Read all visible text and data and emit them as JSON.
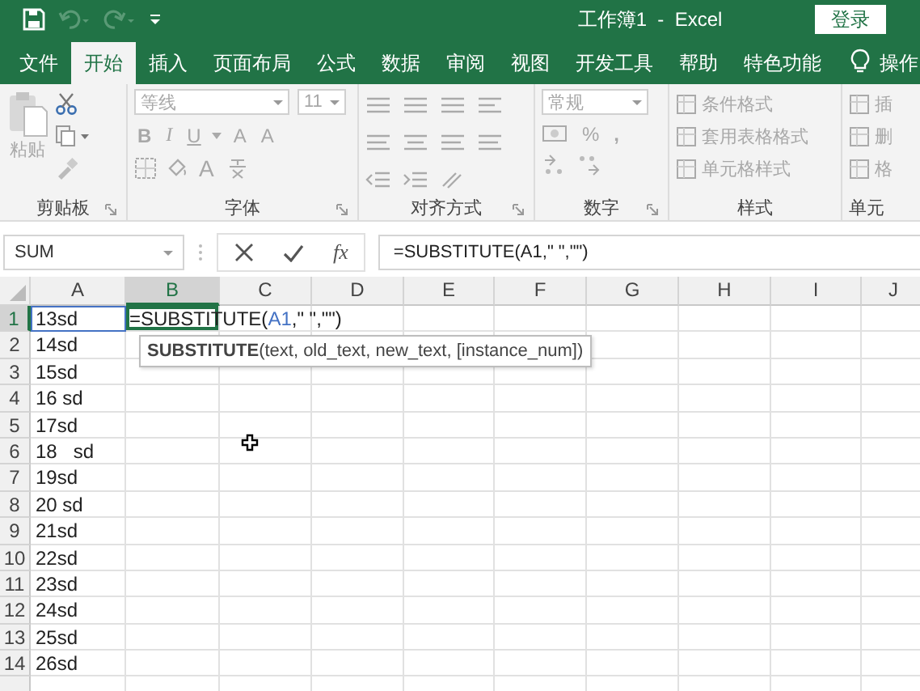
{
  "window": {
    "title": "工作簿1  -  Excel",
    "login": "登录"
  },
  "tabs": [
    {
      "label": "文件",
      "selected": false
    },
    {
      "label": "开始",
      "selected": true
    },
    {
      "label": "插入",
      "selected": false
    },
    {
      "label": "页面布局",
      "selected": false
    },
    {
      "label": "公式",
      "selected": false
    },
    {
      "label": "数据",
      "selected": false
    },
    {
      "label": "审阅",
      "selected": false
    },
    {
      "label": "视图",
      "selected": false
    },
    {
      "label": "开发工具",
      "selected": false
    },
    {
      "label": "帮助",
      "selected": false
    },
    {
      "label": "特色功能",
      "selected": false
    }
  ],
  "tell_me": "操作",
  "ribbon": {
    "disabled": true,
    "groups": [
      {
        "kind": "clipboard",
        "label": "剪贴板",
        "paste": "粘贴"
      },
      {
        "kind": "font",
        "label": "字体",
        "font_name": "等线",
        "font_size": "11",
        "bold": "B",
        "italic": "I",
        "underline": "U",
        "grow": "A",
        "shrink": "A",
        "font_color_glyph": "A"
      },
      {
        "kind": "alignment",
        "label": "对齐方式"
      },
      {
        "kind": "number",
        "label": "数字",
        "format": "常规",
        "percent": "%",
        "comma": ","
      },
      {
        "kind": "styles",
        "label": "样式",
        "items": [
          "条件格式",
          "套用表格格式",
          "单元格样式"
        ]
      },
      {
        "kind": "cells",
        "label": "单元",
        "items": [
          "插",
          "删",
          "格"
        ]
      }
    ]
  },
  "formula_bar": {
    "name_box": "SUM",
    "fx": "fx",
    "formula": "=SUBSTITUTE(A1,\" \",\"\")"
  },
  "sheet": {
    "columns": [
      {
        "label": "A",
        "selected": false
      },
      {
        "label": "B",
        "selected": true
      },
      {
        "label": "C",
        "selected": false
      },
      {
        "label": "D",
        "selected": false
      },
      {
        "label": "E",
        "selected": false
      },
      {
        "label": "F",
        "selected": false
      },
      {
        "label": "G",
        "selected": false
      },
      {
        "label": "H",
        "selected": false
      },
      {
        "label": "I",
        "selected": false
      },
      {
        "label": "J",
        "selected": false
      }
    ],
    "rows": [
      {
        "number": "1",
        "selected": true,
        "a": "13sd"
      },
      {
        "number": "2",
        "selected": false,
        "a": "14sd"
      },
      {
        "number": "3",
        "selected": false,
        "a": "15sd"
      },
      {
        "number": "4",
        "selected": false,
        "a": "16 sd"
      },
      {
        "number": "5",
        "selected": false,
        "a": "17sd"
      },
      {
        "number": "6",
        "selected": false,
        "a": "18   sd"
      },
      {
        "number": "7",
        "selected": false,
        "a": "19sd"
      },
      {
        "number": "8",
        "selected": false,
        "a": "20 sd"
      },
      {
        "number": "9",
        "selected": false,
        "a": "21sd"
      },
      {
        "number": "10",
        "selected": false,
        "a": "22sd"
      },
      {
        "number": "11",
        "selected": false,
        "a": "23sd"
      },
      {
        "number": "12",
        "selected": false,
        "a": "24sd"
      },
      {
        "number": "13",
        "selected": false,
        "a": "25sd"
      },
      {
        "number": "14",
        "selected": false,
        "a": "26sd"
      }
    ],
    "editor": {
      "prefix": "=SUBSTITUTE(",
      "ref": "A1",
      "suffix": ",\" \",\"\")"
    },
    "tooltip": "**SUBSTITUTE**(text, old_text, new_text, [instance_num])"
  }
}
